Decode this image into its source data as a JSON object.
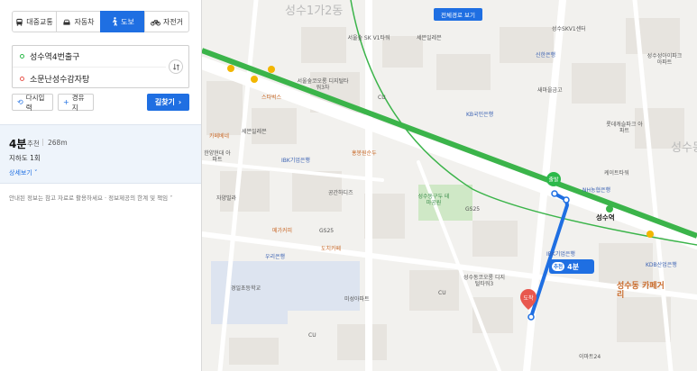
{
  "modes": [
    {
      "label": "대중교통",
      "icon": "bus-icon"
    },
    {
      "label": "자동차",
      "icon": "car-icon"
    },
    {
      "label": "도보",
      "icon": "walk-icon",
      "active": true
    },
    {
      "label": "자전거",
      "icon": "bike-icon"
    }
  ],
  "route": {
    "start": "성수역4번출구",
    "end": "소문난성수감자탕",
    "reset_label": "다시입력",
    "via_label": "경유지",
    "search_label": "길찾기"
  },
  "result": {
    "time": "4분",
    "badge": "추천",
    "distance": "268m",
    "crossings": "지하도 1회",
    "detail_label": "상세보기"
  },
  "notice": "안내된 정보는 참고 자료로 활용하세요 · 정보제공의 한계 및 책임",
  "map": {
    "full_route_label": "전체경로 보기",
    "route_badge": "추천",
    "route_time": "4분",
    "colors": {
      "line2": "#3bb44a",
      "route": "#1f6fe2",
      "building": "#e7e4df",
      "park": "#cfe8c6",
      "school": "#dde4f0",
      "road": "#ffffff"
    },
    "areas": [
      "성수1가2동",
      "성수동"
    ],
    "districts": [
      "성수동 카페거리"
    ],
    "stations": [
      "성수역"
    ],
    "parks": [
      "성수동구두 테마공원"
    ],
    "banks": [
      "IBK기업은행",
      "IBK기업은행",
      "신한은행",
      "우리은행",
      "NH농협은행",
      "KB국민은행",
      "KDB산업은행"
    ],
    "markers": {
      "start": "출발",
      "end": "도착"
    },
    "places": [
      "세븐일레븐",
      "세븐일레븐",
      "성수역",
      "GS25",
      "GS25",
      "CU",
      "CU",
      "CU",
      "도치카페",
      "메가커피",
      "스타벅스",
      "카페베네",
      "자양빌라",
      "공간하디즈",
      "한양현대 아파트",
      "서울숲코오롱 디지털타워3차",
      "서울숲 SK V1타워",
      "홍봉원순두",
      "이마트24",
      "성수SKV1센터",
      "새마을금고",
      "롯데캐슬파크 아파트",
      "성수성아이파크 아파트",
      "성수구두 테마공원",
      "성수동코오롱 디지털타워3",
      "경일초등학교",
      "미성아파트",
      "케이트타워"
    ]
  }
}
